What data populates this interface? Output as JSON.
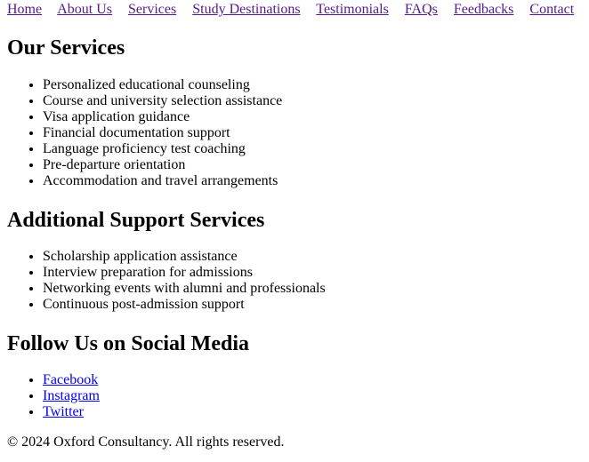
{
  "nav": {
    "items": [
      {
        "label": "Home"
      },
      {
        "label": "About Us"
      },
      {
        "label": "Services"
      },
      {
        "label": "Study Destinations"
      },
      {
        "label": "Testimonials"
      },
      {
        "label": "FAQs"
      },
      {
        "label": "Feedbacks"
      },
      {
        "label": "Contact"
      }
    ]
  },
  "services": {
    "title": "Our Services",
    "items": [
      "Personalized educational counseling",
      "Course and university selection assistance",
      "Visa application guidance",
      "Financial documentation support",
      "Language proficiency test coaching",
      "Pre-departure orientation",
      "Accommodation and travel arrangements"
    ]
  },
  "additional": {
    "title": "Additional Support Services",
    "items": [
      "Scholarship application assistance",
      "Interview preparation for admissions",
      "Networking events with alumni and professionals",
      "Continuous post-admission support"
    ]
  },
  "social": {
    "title": "Follow Us on Social Media",
    "links": [
      {
        "label": "Facebook"
      },
      {
        "label": "Instagram"
      },
      {
        "label": "Twitter"
      }
    ]
  },
  "footer": {
    "text": "© 2024 Oxford Consultancy. All rights reserved."
  },
  "colors": {
    "visited_link": "#551a8b",
    "link": "#0000ee",
    "text": "#000000",
    "background": "#ffffff"
  }
}
